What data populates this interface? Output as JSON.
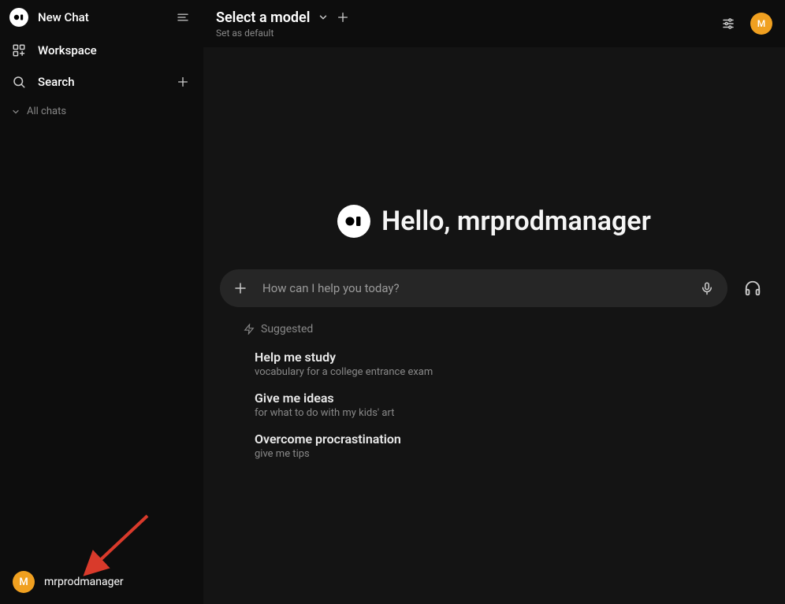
{
  "sidebar": {
    "new_chat_label": "New Chat",
    "workspace_label": "Workspace",
    "search_label": "Search",
    "all_chats_label": "All chats"
  },
  "user": {
    "name": "mrprodmanager",
    "initial": "M"
  },
  "topbar": {
    "model_label": "Select a model",
    "set_default_label": "Set as default"
  },
  "greeting": {
    "text": "Hello, mrprodmanager"
  },
  "input": {
    "placeholder": "How can I help you today?"
  },
  "suggested": {
    "head": "Suggested",
    "items": [
      {
        "title": "Help me study",
        "sub": "vocabulary for a college entrance exam"
      },
      {
        "title": "Give me ideas",
        "sub": "for what to do with my kids' art"
      },
      {
        "title": "Overcome procrastination",
        "sub": "give me tips"
      }
    ]
  },
  "colors": {
    "accent": "#f0a020",
    "arrow": "#d93a2b"
  }
}
